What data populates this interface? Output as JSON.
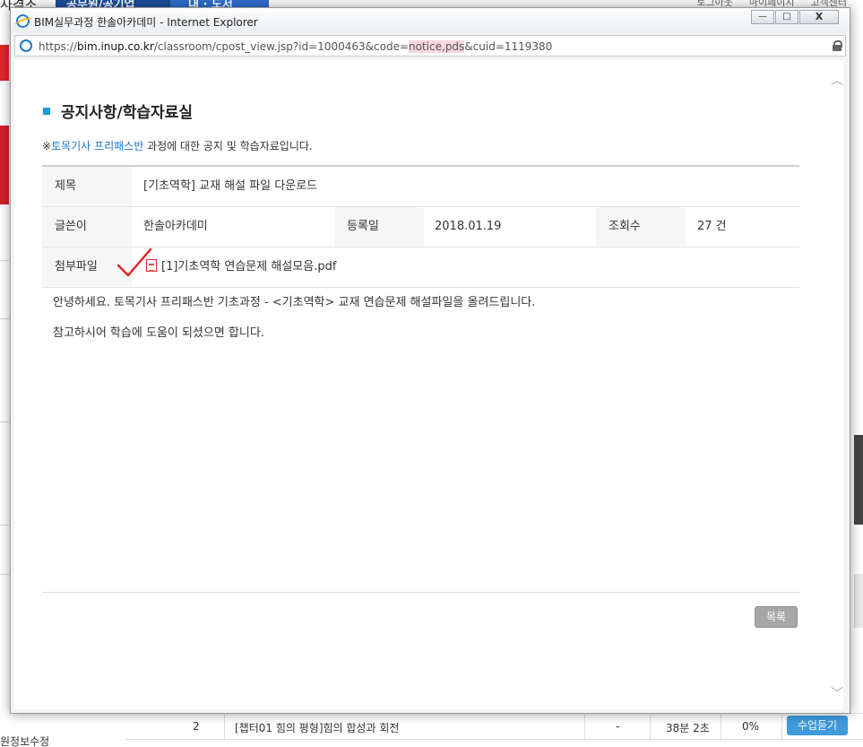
{
  "background": {
    "top_left_text": "사격조",
    "nav_item_1": "공무원/공기업",
    "nav_item_2": "내 · 도서",
    "top_links": [
      "로그아웃",
      "마이페이지",
      "고객센터"
    ],
    "row": {
      "number": "2",
      "title": "[챕터01 힘의 평형]힘의 합성과 회전",
      "dash": "-",
      "duration": "38분 2초",
      "progress": "0%",
      "watch_button": "수업듣기"
    },
    "bottom_left_text": "원정보수정"
  },
  "window": {
    "title": "BIM실무과정 한솔아카데미 - Internet Explorer",
    "buttons": {
      "minimize": "—",
      "maximize": "□",
      "close": "X"
    },
    "url": {
      "prefix": "https://",
      "host": "bim.inup.co.kr",
      "path": "/classroom/cpost_view.jsp?id=1000463&code=",
      "highlight": "notice,pds",
      "suffix": "&cuid=1119380"
    }
  },
  "page": {
    "title": "공지사항/학습자료실",
    "description_mark": "※",
    "course_name": "토목기사 프리패스반",
    "description_rest": " 과정에 대한 공지 및 학습자료입니다.",
    "labels": {
      "subject": "제목",
      "writer": "글쓴이",
      "date": "등록일",
      "views": "조회수",
      "attachment": "첨부파일"
    },
    "subject": "[기초역학] 교재 해설 파일 다운로드",
    "writer": "한솔아카데미",
    "date": "2018.01.19",
    "views": "27 건",
    "attachment_file": "[1]기초역학 연습문제 해설모음.pdf",
    "body": [
      "안녕하세요. 토목기사 프리패스반 기초과정 - <기초역학> 교재 연습문제 해설파일을 올려드립니다.",
      "참고하시어 학습에 도움이 되셨으면 합니다."
    ],
    "list_button": "목록"
  },
  "colors": {
    "accent_blue": "#1a9be0",
    "link_blue": "#1a78c8",
    "check_red": "#e02020",
    "button_gray": "#a7a7a7"
  }
}
